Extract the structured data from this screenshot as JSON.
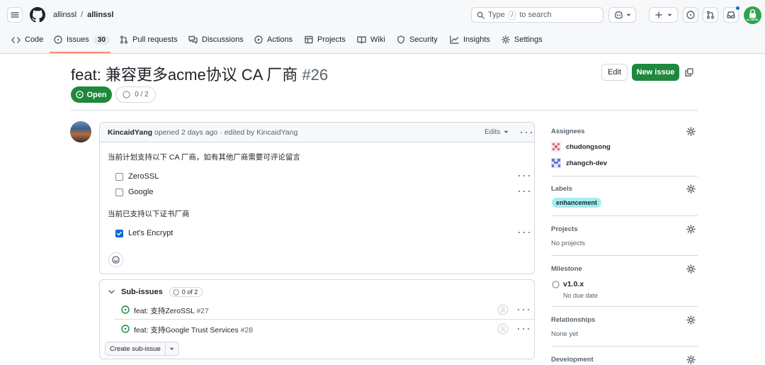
{
  "repo": {
    "owner": "allinssl",
    "separator": "/",
    "name": "allinssl"
  },
  "search": {
    "prefix": "Type",
    "key": "/",
    "suffix": "to search"
  },
  "avatar_user": {
    "label": "ALLINSSL"
  },
  "nav": {
    "tabs": [
      {
        "label": "Code"
      },
      {
        "label": "Issues",
        "count": "30"
      },
      {
        "label": "Pull requests"
      },
      {
        "label": "Discussions"
      },
      {
        "label": "Actions"
      },
      {
        "label": "Projects"
      },
      {
        "label": "Wiki"
      },
      {
        "label": "Security"
      },
      {
        "label": "Insights"
      },
      {
        "label": "Settings"
      }
    ]
  },
  "issue": {
    "title": "feat: 兼容更多acme协议 CA 厂商",
    "number": "#26",
    "state": "Open",
    "progress": "0 / 2",
    "edit_label": "Edit",
    "new_issue_label": "New issue"
  },
  "comment": {
    "author": "KincaidYang",
    "meta": "opened 2 days ago · edited by KincaidYang",
    "edits_label": "Edits",
    "intro": "当前计划支持以下 CA 厂商，如有其他厂商需要可评论留言",
    "todo": [
      {
        "label": "ZeroSSL",
        "checked": false
      },
      {
        "label": "Google",
        "checked": false
      }
    ],
    "done_intro": "当前已支持以下证书厂商",
    "done": [
      {
        "label": "Let's Encrypt",
        "checked": true
      }
    ]
  },
  "subissues": {
    "title": "Sub-issues",
    "count": "0 of 2",
    "items": [
      {
        "title": "feat: 支持ZeroSSL",
        "number": "#27"
      },
      {
        "title": "feat: 支持Google Trust Services",
        "number": "#28"
      }
    ],
    "create_label": "Create sub-issue"
  },
  "sidebar": {
    "assignees": {
      "heading": "Assignees",
      "users": [
        "chudongsong",
        "zhangch-dev"
      ]
    },
    "labels": {
      "heading": "Labels",
      "items": [
        {
          "name": "enhancement",
          "color": "#a2eeef"
        }
      ]
    },
    "projects": {
      "heading": "Projects",
      "value": "No projects"
    },
    "milestone": {
      "heading": "Milestone",
      "name": "v1.0.x",
      "due": "No due date"
    },
    "relationships": {
      "heading": "Relationships",
      "value": "None yet"
    },
    "development": {
      "heading": "Development"
    }
  },
  "colors": {
    "accent_green": "#1f883d",
    "link_blue": "#0969da",
    "label_bg": "#a2eeef"
  }
}
